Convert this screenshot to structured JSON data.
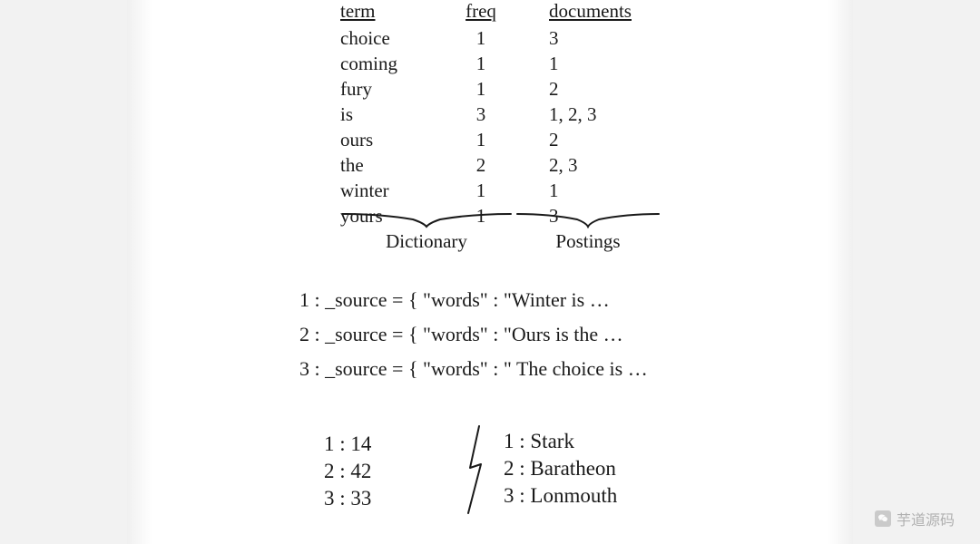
{
  "table": {
    "headers": {
      "term": "term",
      "freq": "freq",
      "documents": "documents"
    },
    "rows": [
      {
        "term": "choice",
        "freq": "1",
        "documents": "3"
      },
      {
        "term": "coming",
        "freq": "1",
        "documents": "1"
      },
      {
        "term": "fury",
        "freq": "1",
        "documents": "2"
      },
      {
        "term": "is",
        "freq": "3",
        "documents": "1, 2, 3"
      },
      {
        "term": "ours",
        "freq": "1",
        "documents": "2"
      },
      {
        "term": "the",
        "freq": "2",
        "documents": "2, 3"
      },
      {
        "term": "winter",
        "freq": "1",
        "documents": "1"
      },
      {
        "term": "yours",
        "freq": "1",
        "documents": "3"
      }
    ],
    "brace_labels": {
      "dictionary": "Dictionary",
      "postings": "Postings"
    }
  },
  "sources": [
    {
      "id": "1",
      "text": "_source = { \"words\" :  \"Winter is …"
    },
    {
      "id": "2",
      "text": "_source = { \"words\" :  \"Ours  is the …"
    },
    {
      "id": "3",
      "text": "_source = { \"words\" :  \" The choice is …"
    }
  ],
  "bottom": {
    "numbers": [
      {
        "id": "1",
        "val": "14"
      },
      {
        "id": "2",
        "val": "42"
      },
      {
        "id": "3",
        "val": "33"
      }
    ],
    "names": [
      {
        "id": "1",
        "val": "Stark"
      },
      {
        "id": "2",
        "val": "Baratheon"
      },
      {
        "id": "3",
        "val": "Lonmouth"
      }
    ]
  },
  "watermark": "芋道源码"
}
